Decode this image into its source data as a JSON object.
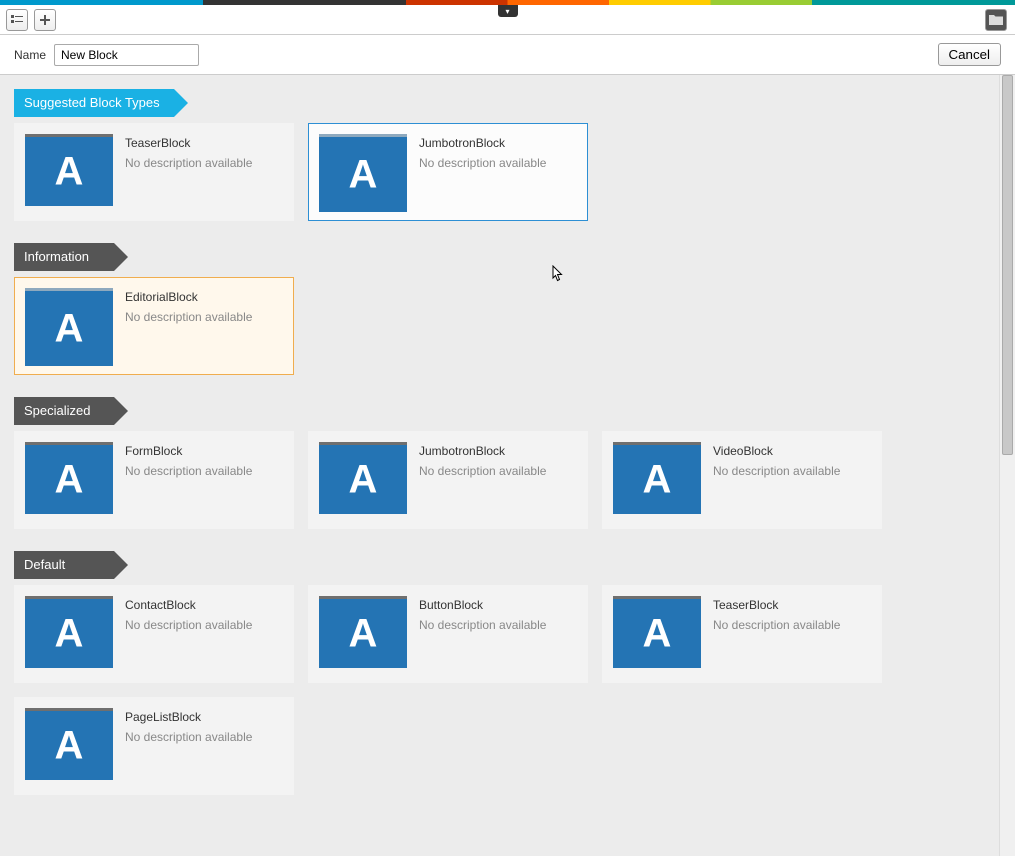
{
  "name_label": "Name",
  "name_value": "New Block",
  "cancel_label": "Cancel",
  "sections": [
    {
      "title": "Suggested Block Types",
      "style": "blue",
      "cards": [
        {
          "title": "TeaserBlock",
          "desc": "No description available",
          "state": ""
        },
        {
          "title": "JumbotronBlock",
          "desc": "No description available",
          "state": "highlight-blue"
        }
      ]
    },
    {
      "title": "Information",
      "style": "gray",
      "cards": [
        {
          "title": "EditorialBlock",
          "desc": "No description available",
          "state": "highlight-orange"
        }
      ]
    },
    {
      "title": "Specialized",
      "style": "gray",
      "cards": [
        {
          "title": "FormBlock",
          "desc": "No description available",
          "state": ""
        },
        {
          "title": "JumbotronBlock",
          "desc": "No description available",
          "state": ""
        },
        {
          "title": "VideoBlock",
          "desc": "No description available",
          "state": ""
        }
      ]
    },
    {
      "title": "Default",
      "style": "gray",
      "cards": [
        {
          "title": "ContactBlock",
          "desc": "No description available",
          "state": ""
        },
        {
          "title": "ButtonBlock",
          "desc": "No description available",
          "state": ""
        },
        {
          "title": "TeaserBlock",
          "desc": "No description available",
          "state": ""
        },
        {
          "title": "PageListBlock",
          "desc": "No description available",
          "state": ""
        }
      ]
    }
  ]
}
